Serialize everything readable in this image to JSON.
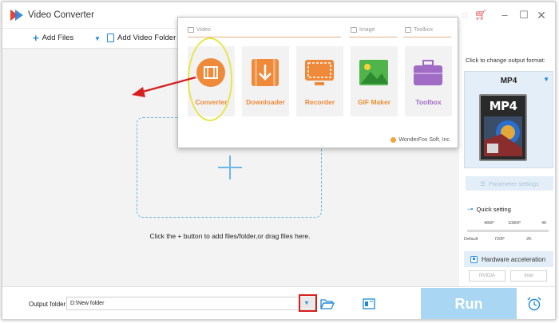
{
  "app": {
    "title": "Video Converter"
  },
  "toolbar": {
    "add_files": "Add Files",
    "add_video_folder": "Add Video Folder"
  },
  "droparea": {
    "hint": "Click the + button to add files/folder,or drag files here."
  },
  "popup": {
    "sections": {
      "video": "Video",
      "image": "Image",
      "toolbox": "Toolbox"
    },
    "tiles": [
      {
        "label": "Converter",
        "color": "#ef8a3a"
      },
      {
        "label": "Downloader",
        "color": "#ef8a3a"
      },
      {
        "label": "Recorder",
        "color": "#ef8a3a"
      },
      {
        "label": "GIF Maker",
        "color": "#e9902f"
      },
      {
        "label": "Toolbox",
        "color": "#a06bc5"
      }
    ],
    "footer": "WonderFox Soft, Inc."
  },
  "rightpanel": {
    "caption": "Click to change output format:",
    "format": "MP4",
    "format_card": "MP4",
    "parameter_settings": "Parameter settings",
    "quick_setting": "Quick setting",
    "ticks_top": [
      "480P",
      "1080P",
      "4K"
    ],
    "ticks_bottom": [
      "Default",
      "720P",
      "2K"
    ],
    "quality_level": 0,
    "hardware_acceleration": "Hardware acceleration",
    "gpu_nvidia": "NVIDIA",
    "gpu_intel": "Intel"
  },
  "bottombar": {
    "output_label": "Output folder:",
    "output_path": "D:\\New folder",
    "run_label": "Run"
  },
  "colors": {
    "accent": "#1e88d8",
    "run_button": "#a8d6f3",
    "annotation_red": "#d81f1f",
    "annotation_yellow": "#e6e64a"
  }
}
